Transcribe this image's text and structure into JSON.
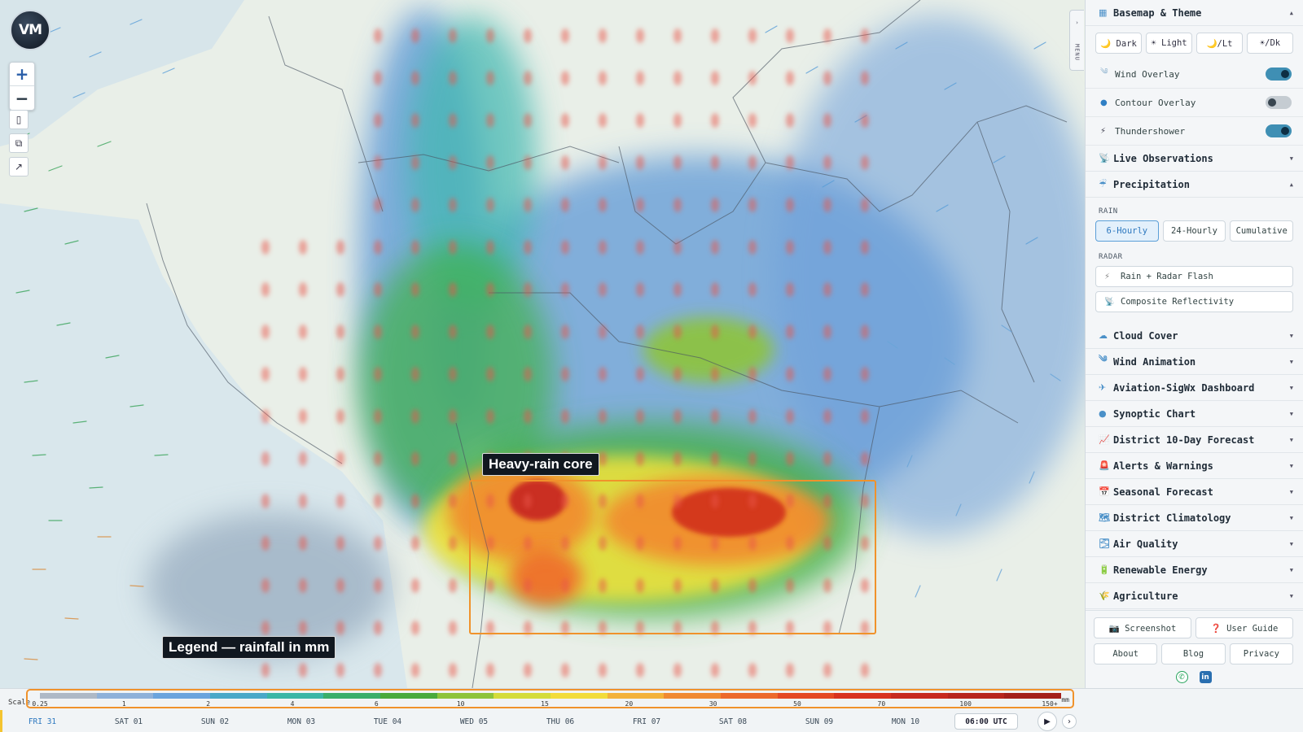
{
  "map": {
    "logo_text": "VM",
    "zoom_in": "+",
    "zoom_out": "−",
    "tool_icons": [
      "bookmark-icon",
      "camera-icon",
      "expand-icon"
    ],
    "annotation_core": "Heavy-rain core",
    "annotation_legend": "Legend — rainfall in mm",
    "menu_tab_text": "MENU",
    "colors": {
      "annotation_border": "#f0922b",
      "rain_low": "#5a96d6",
      "rain_mid": "#3fb24a",
      "rain_high": "#f5e33a",
      "rain_heavy": "#e9442a"
    }
  },
  "sidebar": {
    "basemap": {
      "icon": "map-icon",
      "title": "Basemap & Theme",
      "themes": [
        "🌙 Dark",
        "☀ Light",
        "🌙/Lt",
        "☀/Dk"
      ]
    },
    "toggles": [
      {
        "icon": "wind-icon",
        "glyph": "༄",
        "label": "Wind Overlay",
        "state": "on"
      },
      {
        "icon": "contour-icon",
        "glyph": "●",
        "label": "Contour Overlay",
        "state": "off"
      },
      {
        "icon": "lightning-icon",
        "glyph": "⚡",
        "label": "Thundershower",
        "state": "on"
      }
    ],
    "live_obs": {
      "glyph": "📡",
      "title": "Live Observations"
    },
    "precipitation": {
      "glyph": "☔",
      "title": "Precipitation",
      "rain_label": "RAIN",
      "rain_buttons": [
        "6-Hourly",
        "24-Hourly",
        "Cumulative"
      ],
      "active_rain": "6-Hourly",
      "radar_label": "RADAR",
      "radar_buttons": [
        {
          "glyph": "⚡",
          "label": "Rain + Radar Flash"
        },
        {
          "glyph": "📡",
          "label": "Composite Reflectivity"
        }
      ]
    },
    "sections": [
      {
        "glyph": "☁",
        "label": "Cloud Cover"
      },
      {
        "glyph": "༄",
        "label": "Wind Animation"
      },
      {
        "glyph": "✈",
        "label": "Aviation-SigWx Dashboard"
      },
      {
        "glyph": "●",
        "label": "Synoptic Chart"
      },
      {
        "glyph": "📈",
        "label": "District 10-Day Forecast"
      },
      {
        "glyph": "🚨",
        "label": "Alerts & Warnings"
      },
      {
        "glyph": "📅",
        "label": "Seasonal Forecast"
      },
      {
        "glyph": "🗺",
        "label": "District Climatology"
      },
      {
        "glyph": "🌫",
        "label": "Air Quality"
      },
      {
        "glyph": "🔋",
        "label": "Renewable Energy"
      },
      {
        "glyph": "🌾",
        "label": "Agriculture"
      }
    ],
    "footer": {
      "screenshot": "📷 Screenshot",
      "user_guide": "❓ User Guide",
      "about": "About",
      "blog": "Blog",
      "privacy": "Privacy",
      "social": [
        "whatsapp-icon",
        "linkedin-icon"
      ]
    }
  },
  "timeline": {
    "scale_label": "Scale",
    "scale_ticks": [
      "0.25",
      "1",
      "2",
      "4",
      "6",
      "10",
      "15",
      "20",
      "30",
      "50",
      "70",
      "100",
      "150+"
    ],
    "scale_unit": "mm",
    "scale_colors": [
      "#aeb9c6",
      "#8eb1d9",
      "#6aa4dd",
      "#4aa8c8",
      "#3bb6a6",
      "#3aae6a",
      "#4aaa3c",
      "#8ec43a",
      "#d4dc3a",
      "#f2dc3a",
      "#f3b23a",
      "#f08a33",
      "#ec6a2c",
      "#e44a24",
      "#d8321f",
      "#c72a1e",
      "#b7261d",
      "#a4201a"
    ],
    "days": [
      "FRI 31",
      "SAT 01",
      "SUN 02",
      "MON 03",
      "TUE 04",
      "WED 05",
      "THU 06",
      "FRI 07",
      "SAT 08",
      "SUN 09",
      "MON 10"
    ],
    "active_day": "FRI 31",
    "time": "06:00 UTC",
    "play_icon": "▶",
    "next_icon": "›"
  }
}
